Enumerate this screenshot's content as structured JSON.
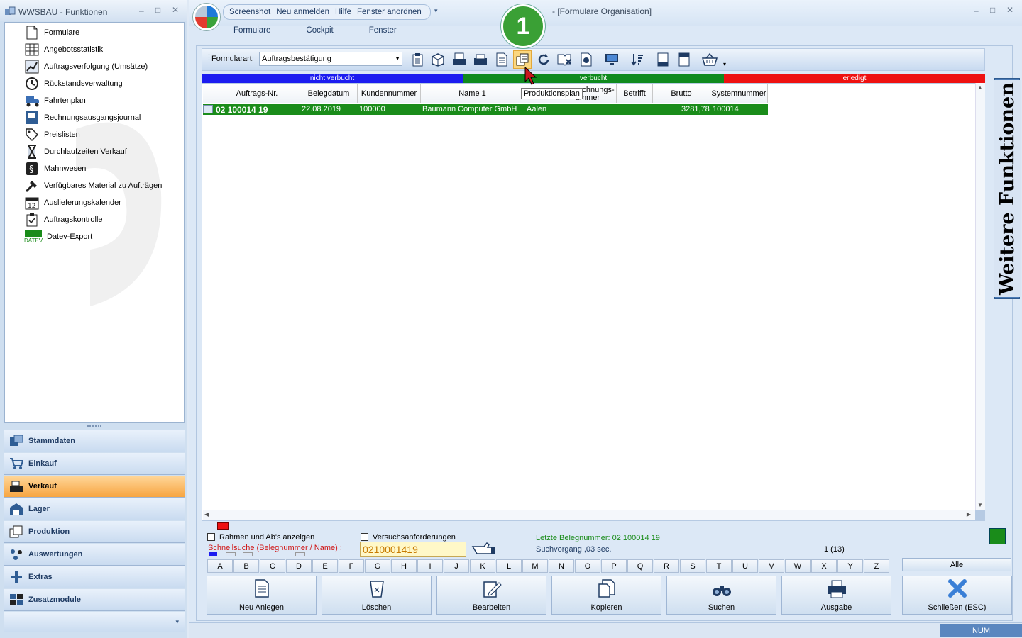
{
  "left_window": {
    "title": "WWSBAU - Funktionen",
    "tree": [
      {
        "label": "Formulare",
        "icon": "document-icon"
      },
      {
        "label": "Angebotsstatistik",
        "icon": "table-icon"
      },
      {
        "label": "Auftragsverfolgung (Umsätze)",
        "icon": "chart-icon"
      },
      {
        "label": "Rückstandsverwaltung",
        "icon": "clock-icon"
      },
      {
        "label": "Fahrtenplan",
        "icon": "truck-icon"
      },
      {
        "label": "Rechnungsausgangsjournal",
        "icon": "journal-icon"
      },
      {
        "label": "Preislisten",
        "icon": "tag-icon"
      },
      {
        "label": "Durchlaufzeiten Verkauf",
        "icon": "hourglass-icon"
      },
      {
        "label": "Mahnwesen",
        "icon": "paragraph-icon"
      },
      {
        "label": "Verfügbares Material zu Aufträgen",
        "icon": "hammer-icon"
      },
      {
        "label": "Auslieferungskalender",
        "icon": "calendar-icon"
      },
      {
        "label": "Auftragskontrolle",
        "icon": "clipboard-icon"
      },
      {
        "label": "Datev-Export",
        "icon": "datev-icon"
      }
    ],
    "datev_tag": "DATEV",
    "calendar_num": "12",
    "nav": [
      {
        "label": "Stammdaten",
        "icon": "stammdaten-icon"
      },
      {
        "label": "Einkauf",
        "icon": "cart-icon"
      },
      {
        "label": "Verkauf",
        "icon": "register-icon"
      },
      {
        "label": "Lager",
        "icon": "warehouse-icon"
      },
      {
        "label": "Produktion",
        "icon": "production-icon"
      },
      {
        "label": "Auswertungen",
        "icon": "analysis-icon"
      },
      {
        "label": "Extras",
        "icon": "extras-icon"
      },
      {
        "label": "Zusatzmodule",
        "icon": "modules-icon"
      }
    ]
  },
  "main_window": {
    "title": "- [Formulare Organisation]",
    "quick_access": [
      "Screenshot",
      "Neu anmelden",
      "Hilfe",
      "Fenster anordnen"
    ],
    "ribbon_tabs": [
      "Formulare",
      "Cockpit",
      "Fenster"
    ],
    "formularart_label": "Formularart:",
    "formularart_value": "Auftragsbestätigung",
    "tooltip": "Produktionsplan",
    "badge": "1",
    "status_bands": [
      {
        "label": "nicht verbucht",
        "color": "#1c1cf0"
      },
      {
        "label": "verbucht",
        "color": "#0f8a1d"
      },
      {
        "label": "erledigt",
        "color": "#ee1111"
      }
    ],
    "columns": [
      "Auftrags-Nr.",
      "Belegdatum",
      "Kundennummer",
      "Name 1",
      "",
      "Rechnungs-\nnummer",
      "Betrifft",
      "Brutto",
      "Systemnummer"
    ],
    "column_rechnung_top": "chnungs-",
    "column_rechnung_bottom": "ummer",
    "rows": [
      {
        "auftrag": "02 100014 19",
        "datum": "22.08.2019",
        "kunde": "100000",
        "name": "Baumann Computer GmbH",
        "ort": "Aalen",
        "brutto": "3281,78",
        "system": "100014"
      }
    ],
    "rahmen_label": "Rahmen und Ab's anzeigen",
    "versuch_label": "Versuchsanforderungen",
    "schnellsuche_label": "Schnellsuche (Belegnummer / Name) :",
    "search_value": "0210001419",
    "letzte_label": "Letzte Belegnummer: 02 100014 19",
    "suchvorgang_label": "Suchvorgang ,03 sec.",
    "count": "1  (13)",
    "letters": [
      "A",
      "B",
      "C",
      "D",
      "E",
      "F",
      "G",
      "H",
      "I",
      "J",
      "K",
      "L",
      "M",
      "N",
      "O",
      "P",
      "Q",
      "R",
      "S",
      "T",
      "U",
      "V",
      "W",
      "X",
      "Y",
      "Z"
    ],
    "alle": "Alle",
    "buttons": [
      {
        "label": "Neu Anlegen",
        "icon": "new-doc-icon"
      },
      {
        "label": "Löschen",
        "icon": "trash-icon"
      },
      {
        "label": "Bearbeiten",
        "icon": "edit-icon"
      },
      {
        "label": "Kopieren",
        "icon": "copy-icon"
      },
      {
        "label": "Suchen",
        "icon": "binoculars-icon"
      },
      {
        "label": "Ausgabe",
        "icon": "printer-icon"
      },
      {
        "label": "Schließen (ESC)",
        "icon": "close-x-icon"
      }
    ],
    "side_panel": "Weitere Funktionen",
    "status_num": "NUM"
  }
}
